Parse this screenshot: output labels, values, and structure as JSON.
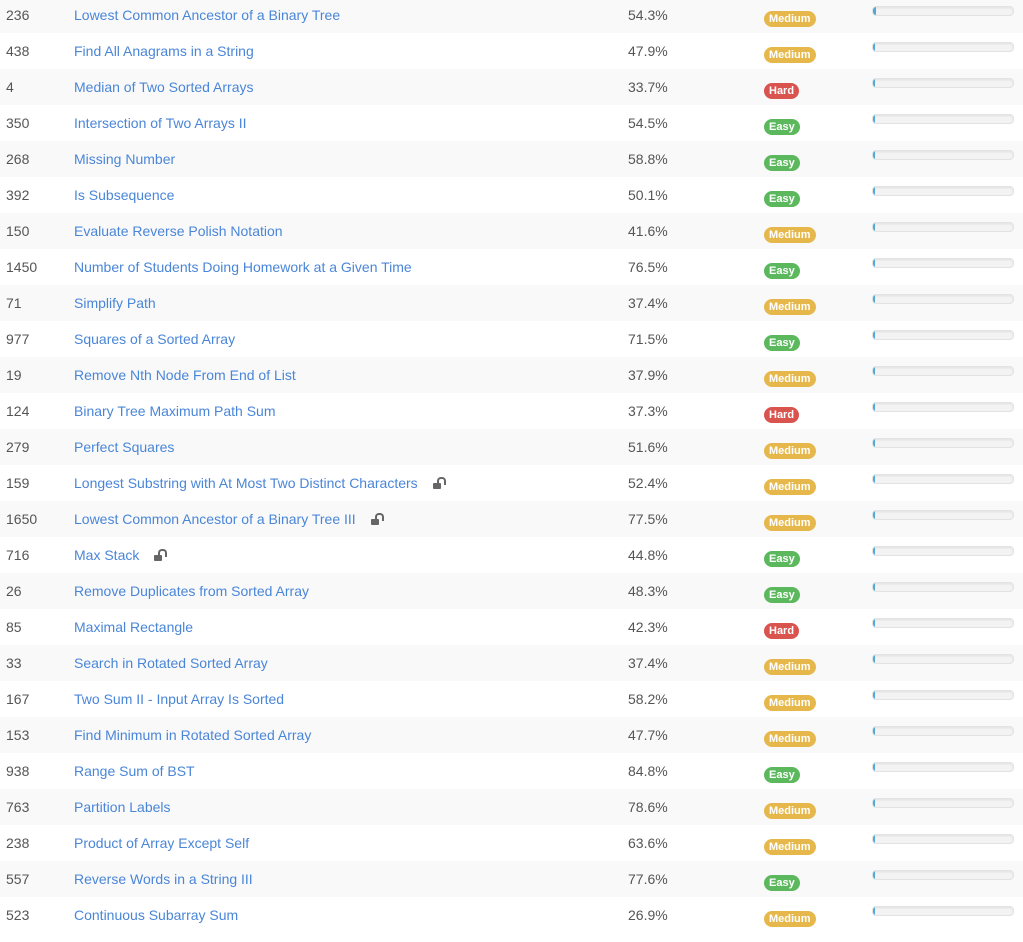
{
  "colors": {
    "link": "#4a86d8",
    "medium": "#e6b84b",
    "easy": "#5cb85c",
    "hard": "#d9534f",
    "frequency": "#4fa8d8"
  },
  "icons": {
    "lock": "unlock-icon"
  },
  "problems": [
    {
      "id": "236",
      "title": "Lowest Common Ancestor of a Binary Tree",
      "acceptance": "54.3%",
      "difficulty": "Medium",
      "locked": false,
      "frequency": 0.02
    },
    {
      "id": "438",
      "title": "Find All Anagrams in a String",
      "acceptance": "47.9%",
      "difficulty": "Medium",
      "locked": false,
      "frequency": 0.01
    },
    {
      "id": "4",
      "title": "Median of Two Sorted Arrays",
      "acceptance": "33.7%",
      "difficulty": "Hard",
      "locked": false,
      "frequency": 0.01
    },
    {
      "id": "350",
      "title": "Intersection of Two Arrays II",
      "acceptance": "54.5%",
      "difficulty": "Easy",
      "locked": false,
      "frequency": 0.01
    },
    {
      "id": "268",
      "title": "Missing Number",
      "acceptance": "58.8%",
      "difficulty": "Easy",
      "locked": false,
      "frequency": 0.01
    },
    {
      "id": "392",
      "title": "Is Subsequence",
      "acceptance": "50.1%",
      "difficulty": "Easy",
      "locked": false,
      "frequency": 0.01
    },
    {
      "id": "150",
      "title": "Evaluate Reverse Polish Notation",
      "acceptance": "41.6%",
      "difficulty": "Medium",
      "locked": false,
      "frequency": 0.01
    },
    {
      "id": "1450",
      "title": "Number of Students Doing Homework at a Given Time",
      "acceptance": "76.5%",
      "difficulty": "Easy",
      "locked": false,
      "frequency": 0.01
    },
    {
      "id": "71",
      "title": "Simplify Path",
      "acceptance": "37.4%",
      "difficulty": "Medium",
      "locked": false,
      "frequency": 0.01
    },
    {
      "id": "977",
      "title": "Squares of a Sorted Array",
      "acceptance": "71.5%",
      "difficulty": "Easy",
      "locked": false,
      "frequency": 0.005
    },
    {
      "id": "19",
      "title": "Remove Nth Node From End of List",
      "acceptance": "37.9%",
      "difficulty": "Medium",
      "locked": false,
      "frequency": 0.005
    },
    {
      "id": "124",
      "title": "Binary Tree Maximum Path Sum",
      "acceptance": "37.3%",
      "difficulty": "Hard",
      "locked": false,
      "frequency": 0.005
    },
    {
      "id": "279",
      "title": "Perfect Squares",
      "acceptance": "51.6%",
      "difficulty": "Medium",
      "locked": false,
      "frequency": 0.005
    },
    {
      "id": "159",
      "title": "Longest Substring with At Most Two Distinct Characters",
      "acceptance": "52.4%",
      "difficulty": "Medium",
      "locked": true,
      "frequency": 0.005
    },
    {
      "id": "1650",
      "title": "Lowest Common Ancestor of a Binary Tree III",
      "acceptance": "77.5%",
      "difficulty": "Medium",
      "locked": true,
      "frequency": 0.005
    },
    {
      "id": "716",
      "title": "Max Stack",
      "acceptance": "44.8%",
      "difficulty": "Easy",
      "locked": true,
      "frequency": 0.005
    },
    {
      "id": "26",
      "title": "Remove Duplicates from Sorted Array",
      "acceptance": "48.3%",
      "difficulty": "Easy",
      "locked": false,
      "frequency": 0.005
    },
    {
      "id": "85",
      "title": "Maximal Rectangle",
      "acceptance": "42.3%",
      "difficulty": "Hard",
      "locked": false,
      "frequency": 0.005
    },
    {
      "id": "33",
      "title": "Search in Rotated Sorted Array",
      "acceptance": "37.4%",
      "difficulty": "Medium",
      "locked": false,
      "frequency": 0.005
    },
    {
      "id": "167",
      "title": "Two Sum II - Input Array Is Sorted",
      "acceptance": "58.2%",
      "difficulty": "Medium",
      "locked": false,
      "frequency": 0.005
    },
    {
      "id": "153",
      "title": "Find Minimum in Rotated Sorted Array",
      "acceptance": "47.7%",
      "difficulty": "Medium",
      "locked": false,
      "frequency": 0.005
    },
    {
      "id": "938",
      "title": "Range Sum of BST",
      "acceptance": "84.8%",
      "difficulty": "Easy",
      "locked": false,
      "frequency": 0.005
    },
    {
      "id": "763",
      "title": "Partition Labels",
      "acceptance": "78.6%",
      "difficulty": "Medium",
      "locked": false,
      "frequency": 0.005
    },
    {
      "id": "238",
      "title": "Product of Array Except Self",
      "acceptance": "63.6%",
      "difficulty": "Medium",
      "locked": false,
      "frequency": 0.005
    },
    {
      "id": "557",
      "title": "Reverse Words in a String III",
      "acceptance": "77.6%",
      "difficulty": "Easy",
      "locked": false,
      "frequency": 0.005
    },
    {
      "id": "523",
      "title": "Continuous Subarray Sum",
      "acceptance": "26.9%",
      "difficulty": "Medium",
      "locked": false,
      "frequency": 0.005
    }
  ]
}
